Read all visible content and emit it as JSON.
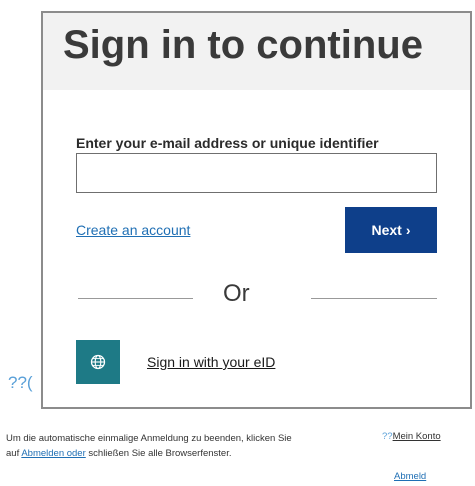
{
  "card": {
    "title": "Sign in to continue",
    "field_label": "Enter your e-mail address or unique identifier",
    "email_value": "",
    "create_account": "Create an account",
    "next_label": "Next",
    "next_arrow": "›",
    "or_text": "Or",
    "eid_label": "Sign in with your eID",
    "eid_icon": "globe-icon"
  },
  "background": {
    "question_marks": "??(",
    "footer_before": "Um die automatische einmalige Anmeldung zu beenden, klicken Sie auf ",
    "footer_link": "Abmelden oder",
    "footer_after": "  schließen Sie alle Browserfenster.",
    "konto_prefix": "??",
    "konto_label": "Mein Konto",
    "abmeld_label": "Abmeld"
  },
  "colors": {
    "next_button": "#0e3f8a",
    "eid_icon_bg": "#1e7a86",
    "link": "#1f6fb4"
  }
}
